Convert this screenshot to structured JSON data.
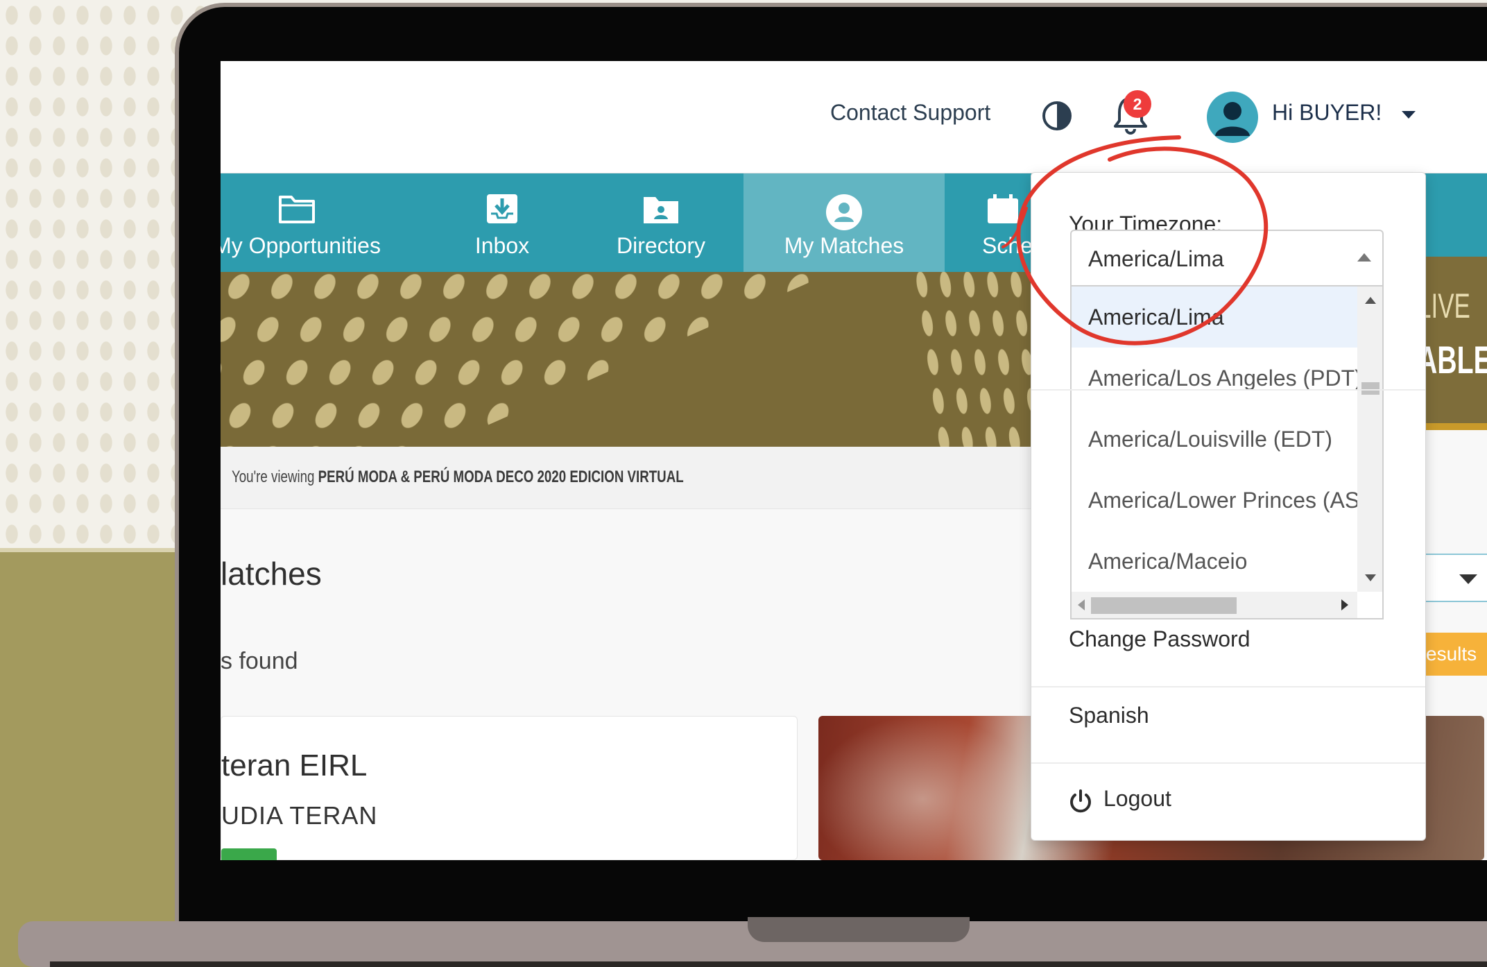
{
  "topbar": {
    "contact_support": "Contact Support",
    "notification_count": "2",
    "greeting": "Hi BUYER!"
  },
  "nav": {
    "items": [
      {
        "label": "My Opportunities",
        "icon": "folder-icon"
      },
      {
        "label": "Inbox",
        "icon": "inbox-icon"
      },
      {
        "label": "Directory",
        "icon": "directory-icon"
      },
      {
        "label": "My Matches",
        "icon": "user-circle-icon",
        "active": true
      },
      {
        "label": "Sche",
        "icon": "schedule-icon"
      }
    ]
  },
  "event_bar": {
    "prefix": "You're viewing",
    "event_name": "PERÚ MODA & PERÚ MODA DECO 2020 EDICION VIRTUAL"
  },
  "main": {
    "heading": "latches",
    "results_found": "s found",
    "card": {
      "company": "teran EIRL",
      "contact": "UDIA TERAN"
    }
  },
  "right_fragments": {
    "banner_text_1": "LIVE",
    "banner_text_2": "ABLE",
    "results_button": "esults"
  },
  "user_menu": {
    "timezone_label": "Your Timezone:",
    "timezone_value": "America/Lima",
    "timezone_options": [
      "America/Lima",
      "America/Los Angeles (PDT)",
      "America/Louisville (EDT)",
      "America/Lower Princes (AST)",
      "America/Maceio"
    ],
    "change_password": "Change Password",
    "language": "Spanish",
    "logout": "Logout"
  },
  "colors": {
    "nav_bg": "#2d9cae",
    "nav_active_bg": "#62b5c2",
    "badge": "#ee3c3c",
    "annotation": "#e0372c"
  }
}
